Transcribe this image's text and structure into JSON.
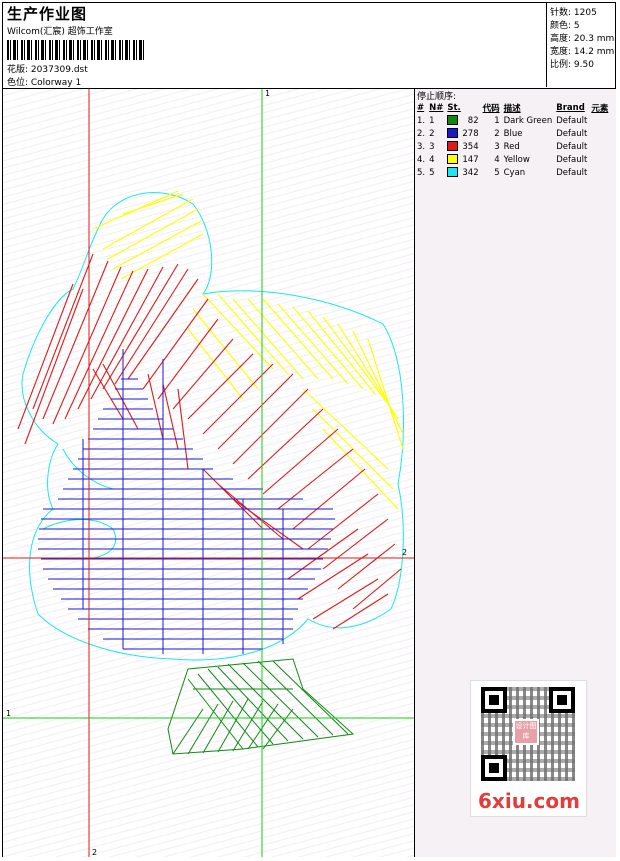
{
  "header": {
    "title": "生产作业图",
    "company": "Wilcom(汇宸) 超饰工作室",
    "design_file": "花版:  2037309.dst",
    "colorway": "色位:  Colorway 1"
  },
  "stats": {
    "stitches": "针数:  1205",
    "colors": "颜色:  5",
    "height": "高度:  20.3 mm",
    "width": "宽度:  14.2 mm",
    "scale": "比例:  9.50"
  },
  "axis_labels": {
    "v1": "1",
    "v2": "2",
    "h1": "1",
    "h2": "2"
  },
  "stop_sequence": {
    "heading": "停止顺序:",
    "columns": [
      "#",
      "N#",
      "St.",
      "代码",
      "描述",
      "Brand",
      "元素"
    ],
    "rows": [
      {
        "idx": "1.",
        "n": "1",
        "color": "#0f8a0f",
        "stitches": "82",
        "code": "1",
        "desc": "Dark Green",
        "brand": "Default"
      },
      {
        "idx": "2.",
        "n": "2",
        "color": "#1a1acc",
        "stitches": "278",
        "code": "2",
        "desc": "Blue",
        "brand": "Default"
      },
      {
        "idx": "3.",
        "n": "3",
        "color": "#e01818",
        "stitches": "354",
        "code": "3",
        "desc": "Red",
        "brand": "Default"
      },
      {
        "idx": "4.",
        "n": "4",
        "color": "#ffff00",
        "stitches": "147",
        "code": "4",
        "desc": "Yellow",
        "brand": "Default"
      },
      {
        "idx": "5.",
        "n": "5",
        "color": "#18e8f0",
        "stitches": "342",
        "code": "5",
        "desc": "Cyan",
        "brand": "Default"
      }
    ]
  },
  "watermark": {
    "site": "6xiu.com",
    "qr_center": "设计图库"
  },
  "colors": {
    "guide_red": "#e01818",
    "guide_green": "#19cc19"
  }
}
